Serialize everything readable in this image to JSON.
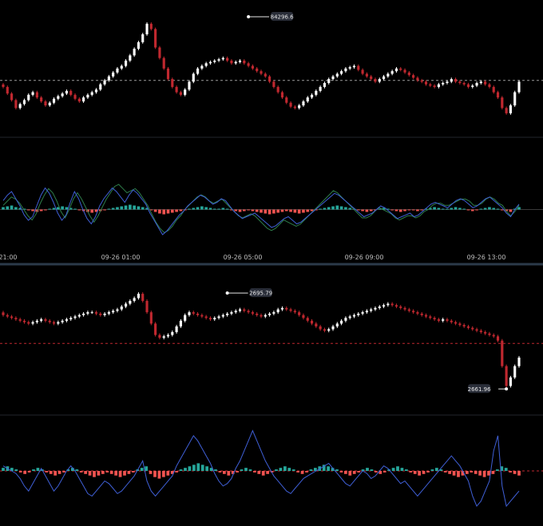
{
  "colors": {
    "background": "#000000",
    "up": "#ffffff",
    "down": "#c0282f",
    "macd_pos": "#26a69a",
    "macd_neg": "#ef5350",
    "line_blue": "#3f5fd6",
    "line_green": "#2e7d4a",
    "separator": "#2b3a4a",
    "divider": "#22262b",
    "ref_top": "#9a9a9a",
    "ref_bottom": "#c0282f"
  },
  "x_axis": {
    "ticks": [
      "21:00",
      "09-26 01:00",
      "09-26 05:00",
      "09-26 09:00",
      "09-26 13:00"
    ]
  },
  "chart_data": [
    {
      "type": "candlestick",
      "name": "top-price",
      "ylim": [
        83860,
        84330
      ],
      "reference_line": 84055,
      "annotation": {
        "label": "84296.6",
        "value": 84296.6,
        "bar_index": 58
      },
      "close": [
        84030,
        84005,
        83980,
        83950,
        83965,
        83980,
        84000,
        84010,
        83990,
        83975,
        83960,
        83970,
        83985,
        83995,
        84005,
        84015,
        84000,
        83985,
        83975,
        83990,
        84000,
        84010,
        84020,
        84040,
        84055,
        84070,
        84085,
        84100,
        84110,
        84130,
        84150,
        84175,
        84200,
        84230,
        84270,
        84250,
        84180,
        84140,
        84100,
        84060,
        84030,
        84010,
        84000,
        84020,
        84050,
        84080,
        84100,
        84110,
        84120,
        84125,
        84130,
        84135,
        84140,
        84130,
        84120,
        84125,
        84130,
        84120,
        84110,
        84100,
        84090,
        84080,
        84070,
        84050,
        84030,
        84010,
        83990,
        83970,
        83955,
        83950,
        83960,
        83975,
        83990,
        84000,
        84015,
        84030,
        84045,
        84060,
        84070,
        84080,
        84090,
        84100,
        84105,
        84110,
        84095,
        84080,
        84070,
        84060,
        84050,
        84060,
        84070,
        84080,
        84090,
        84100,
        84095,
        84085,
        84075,
        84065,
        84055,
        84050,
        84040,
        84035,
        84030,
        84040,
        84045,
        84050,
        84060,
        84050,
        84045,
        84040,
        84030,
        84035,
        84045,
        84050,
        84040,
        84030,
        84010,
        83990,
        83950,
        83930,
        83960,
        84010,
        84050
      ],
      "labels_y_axis": false
    },
    {
      "type": "macd",
      "name": "top-macd",
      "histogram": [
        3,
        4,
        5,
        3,
        2,
        1,
        -1,
        -2,
        -3,
        -2,
        -1,
        1,
        2,
        3,
        4,
        3,
        2,
        1,
        -1,
        -2,
        -3,
        -4,
        -3,
        -2,
        -1,
        1,
        2,
        3,
        4,
        5,
        6,
        5,
        4,
        3,
        2,
        -1,
        -3,
        -5,
        -6,
        -5,
        -4,
        -3,
        -2,
        -1,
        1,
        2,
        3,
        4,
        3,
        2,
        1,
        1,
        2,
        1,
        -1,
        -2,
        -3,
        -2,
        -1,
        -2,
        -3,
        -4,
        -5,
        -6,
        -5,
        -4,
        -3,
        -2,
        -3,
        -4,
        -5,
        -4,
        -3,
        -2,
        -1,
        1,
        2,
        3,
        4,
        5,
        4,
        3,
        2,
        1,
        -1,
        -2,
        -3,
        -2,
        -1,
        1,
        2,
        1,
        -1,
        -2,
        -3,
        -2,
        -1,
        -1,
        -2,
        -1,
        1,
        2,
        3,
        2,
        1,
        1,
        2,
        3,
        2,
        1,
        -1,
        -2,
        -1,
        1,
        2,
        3,
        2,
        1,
        -1,
        -2,
        -3,
        1,
        3
      ],
      "blue": [
        5,
        8,
        10,
        6,
        2,
        -3,
        -6,
        -4,
        2,
        8,
        12,
        9,
        4,
        -2,
        -6,
        -3,
        4,
        10,
        6,
        0,
        -5,
        -8,
        -4,
        2,
        6,
        9,
        12,
        10,
        7,
        4,
        8,
        11,
        9,
        6,
        3,
        -2,
        -6,
        -10,
        -14,
        -12,
        -9,
        -6,
        -3,
        -1,
        2,
        4,
        6,
        8,
        7,
        5,
        3,
        4,
        6,
        5,
        2,
        -1,
        -3,
        -5,
        -4,
        -3,
        -2,
        -4,
        -6,
        -8,
        -10,
        -9,
        -7,
        -5,
        -4,
        -6,
        -8,
        -7,
        -5,
        -3,
        -1,
        1,
        3,
        5,
        7,
        9,
        8,
        6,
        4,
        2,
        0,
        -2,
        -4,
        -3,
        -2,
        0,
        2,
        1,
        -1,
        -3,
        -5,
        -4,
        -3,
        -2,
        -4,
        -3,
        -1,
        1,
        3,
        4,
        3,
        2,
        1,
        3,
        5,
        6,
        5,
        3,
        1,
        2,
        4,
        6,
        7,
        5,
        3,
        1,
        -2,
        -4,
        0,
        3
      ],
      "green": [
        2,
        4,
        6,
        5,
        3,
        0,
        -3,
        -5,
        -2,
        3,
        7,
        10,
        8,
        4,
        -1,
        -4,
        0,
        5,
        8,
        5,
        1,
        -3,
        -6,
        -3,
        1,
        5,
        8,
        11,
        12,
        10,
        8,
        9,
        10,
        8,
        5,
        2,
        -2,
        -6,
        -9,
        -11,
        -10,
        -8,
        -5,
        -3,
        0,
        2,
        4,
        6,
        7,
        6,
        4,
        3,
        4,
        5,
        3,
        1,
        -1,
        -3,
        -4,
        -3,
        -2,
        -3,
        -5,
        -7,
        -9,
        -10,
        -9,
        -7,
        -5,
        -6,
        -7,
        -8,
        -7,
        -5,
        -3,
        -1,
        1,
        3,
        5,
        7,
        9,
        8,
        6,
        4,
        2,
        0,
        -2,
        -4,
        -4,
        -3,
        -1,
        1,
        0,
        -1,
        -2,
        -4,
        -5,
        -4,
        -3,
        -3,
        -4,
        -3,
        -1,
        0,
        2,
        3,
        3,
        2,
        2,
        3,
        4,
        5,
        5,
        4,
        2,
        2,
        3,
        5,
        6,
        5,
        3,
        2,
        -1,
        -3,
        -1,
        2
      ]
    },
    {
      "type": "candlestick",
      "name": "bottom-price",
      "ylim": [
        2655,
        2702
      ],
      "reference_line": 2678,
      "annotations": [
        {
          "label": "2695.79",
          "value": 2695.79,
          "bar_index": 53
        },
        {
          "label": "2661.96",
          "value": 2661.96,
          "bar_index": 119
        }
      ],
      "close": [
        2688,
        2687.5,
        2687,
        2686.5,
        2686,
        2685.5,
        2685,
        2685.5,
        2686,
        2686.5,
        2686,
        2685.5,
        2685,
        2685.5,
        2686,
        2686.5,
        2687,
        2687.5,
        2688,
        2688.5,
        2689,
        2689,
        2688.5,
        2688,
        2688.5,
        2689,
        2689.5,
        2690,
        2691,
        2692,
        2693,
        2694,
        2695.5,
        2693,
        2689,
        2685,
        2681,
        2680,
        2680.5,
        2681,
        2682,
        2684,
        2686,
        2688,
        2689,
        2688.5,
        2688,
        2687.5,
        2687,
        2686.5,
        2687,
        2687.5,
        2688,
        2688.5,
        2689,
        2689.5,
        2690,
        2689.5,
        2689,
        2688.5,
        2688,
        2687.5,
        2688,
        2688.5,
        2689,
        2690,
        2690.5,
        2690,
        2689.5,
        2689,
        2688,
        2687,
        2686,
        2685,
        2684,
        2683,
        2682.5,
        2683,
        2684,
        2685,
        2686,
        2687,
        2687.5,
        2688,
        2688.5,
        2689,
        2689.5,
        2690,
        2690.5,
        2691,
        2691.5,
        2692,
        2691.5,
        2691,
        2690.5,
        2690,
        2689.5,
        2689,
        2688.5,
        2688,
        2687.5,
        2687,
        2686.5,
        2686,
        2686.5,
        2686,
        2685.5,
        2685,
        2684.5,
        2684,
        2683.5,
        2683,
        2682.5,
        2682,
        2681.5,
        2681,
        2680.5,
        2679,
        2670,
        2663,
        2666,
        2670,
        2673
      ],
      "labels_y_axis": false
    },
    {
      "type": "macd",
      "name": "bottom-macd",
      "histogram": [
        2,
        3,
        2,
        1,
        -1,
        -2,
        -1,
        1,
        2,
        1,
        -1,
        -2,
        -3,
        -2,
        -1,
        1,
        2,
        1,
        -1,
        -2,
        -3,
        -4,
        -3,
        -2,
        -1,
        -2,
        -3,
        -4,
        -3,
        -2,
        -1,
        1,
        2,
        3,
        -2,
        -4,
        -5,
        -4,
        -3,
        -2,
        -1,
        1,
        2,
        3,
        4,
        5,
        4,
        3,
        2,
        1,
        -1,
        -2,
        -3,
        -2,
        -1,
        1,
        2,
        1,
        -1,
        -2,
        -3,
        -2,
        -1,
        1,
        2,
        3,
        2,
        1,
        -1,
        -2,
        -1,
        1,
        2,
        3,
        4,
        3,
        2,
        1,
        -1,
        -2,
        -3,
        -2,
        -1,
        1,
        2,
        1,
        -1,
        -2,
        -1,
        1,
        2,
        3,
        2,
        1,
        -1,
        -2,
        -3,
        -2,
        -1,
        1,
        2,
        1,
        -1,
        -2,
        -3,
        -4,
        -3,
        -2,
        -1,
        -2,
        -3,
        -4,
        -3,
        -2,
        1,
        3,
        2,
        -1,
        -2,
        -3
      ],
      "blue": [
        2,
        1,
        0,
        -1,
        -3,
        -6,
        -8,
        -5,
        -2,
        1,
        -2,
        -5,
        -8,
        -6,
        -3,
        0,
        2,
        0,
        -3,
        -6,
        -9,
        -10,
        -8,
        -6,
        -4,
        -5,
        -7,
        -9,
        -8,
        -6,
        -4,
        -2,
        1,
        4,
        -4,
        -8,
        -10,
        -8,
        -6,
        -4,
        -2,
        2,
        5,
        8,
        11,
        14,
        12,
        9,
        6,
        3,
        -1,
        -4,
        -6,
        -5,
        -3,
        1,
        4,
        8,
        12,
        16,
        12,
        8,
        4,
        1,
        -2,
        -4,
        -6,
        -8,
        -9,
        -7,
        -5,
        -3,
        -2,
        -1,
        0,
        1,
        2,
        3,
        1,
        -1,
        -3,
        -5,
        -6,
        -4,
        -2,
        0,
        -1,
        -3,
        -2,
        0,
        2,
        1,
        -1,
        -3,
        -5,
        -4,
        -6,
        -8,
        -10,
        -8,
        -6,
        -4,
        -2,
        0,
        2,
        4,
        6,
        4,
        2,
        -1,
        -4,
        -10,
        -14,
        -12,
        -8,
        -4,
        8,
        14,
        -6,
        -14,
        -12,
        -10,
        -8
      ]
    }
  ]
}
